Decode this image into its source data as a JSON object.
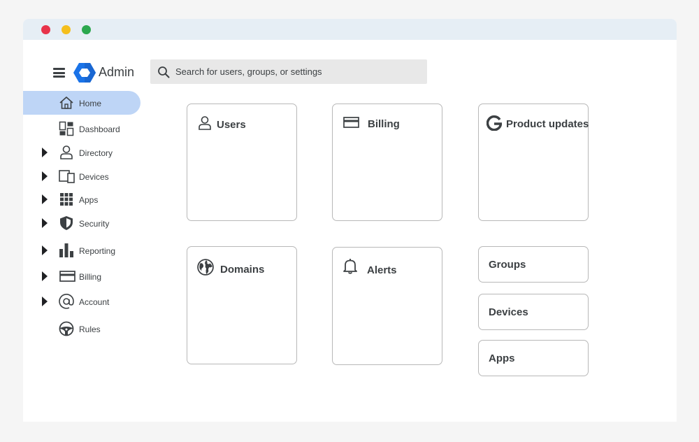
{
  "header": {
    "app_title": "Admin",
    "search_placeholder": "Search for users, groups, or settings"
  },
  "sidebar": {
    "items": [
      {
        "label": "Home"
      },
      {
        "label": "Dashboard"
      },
      {
        "label": "Directory"
      },
      {
        "label": "Devices"
      },
      {
        "label": "Apps"
      },
      {
        "label": "Security"
      },
      {
        "label": "Reporting"
      },
      {
        "label": "Billing"
      },
      {
        "label": "Account"
      },
      {
        "label": "Rules"
      }
    ]
  },
  "cards": {
    "users": "Users",
    "billing": "Billing",
    "product_updates": "Product updates",
    "domains": "Domains",
    "alerts": "Alerts",
    "groups": "Groups",
    "devices": "Devices",
    "apps": "Apps"
  },
  "colors": {
    "active_nav": "#bed5f6",
    "logo_blue": "#1a73e8",
    "titlebar": "#e6eef5"
  }
}
